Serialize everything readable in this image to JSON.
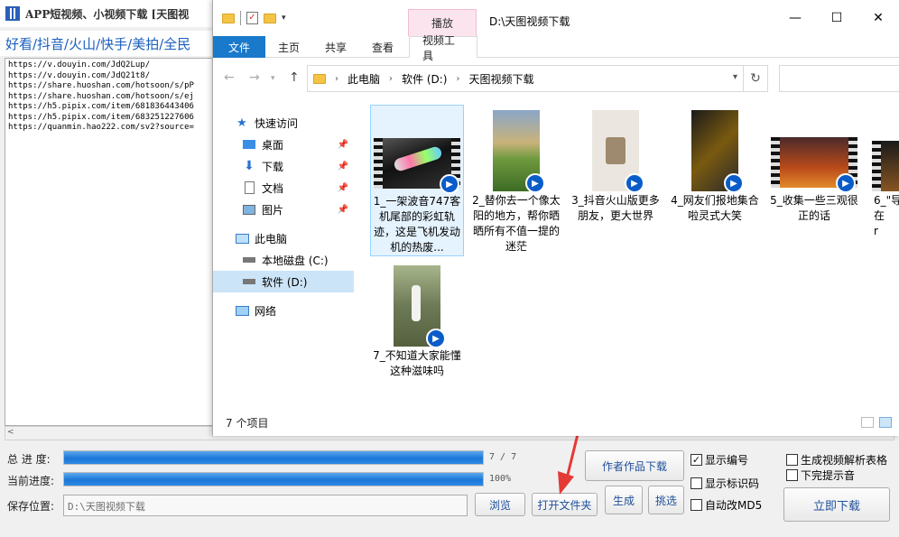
{
  "app": {
    "title": "APP短视频、小视频下载 [天图视",
    "platforms": "好看/抖音/火山/快手/美拍/全民",
    "urls": [
      "https://v.douyin.com/JdQ2Lup/",
      "https://v.douyin.com/JdQ21t8/",
      "https://share.huoshan.com/hotsoon/s/pP",
      "https://share.huoshan.com/hotsoon/s/ej",
      "https://h5.pipix.com/item/681836443406",
      "https://h5.pipix.com/item/683251227606",
      "https://quanmin.hao222.com/sv2?source="
    ],
    "total_progress_label": "总 进 度:",
    "total_progress_text": "7 / 7",
    "total_progress_fraction": 1.0,
    "current_progress_label": "当前进度:",
    "current_progress_text": "100%",
    "current_progress_fraction": 1.0,
    "save_label": "保存位置:",
    "save_path": "D:\\天图视频下载",
    "btn_browse": "浏览",
    "btn_open_folder": "打开文件夹",
    "btn_generate": "生成",
    "btn_pick": "挑选",
    "btn_author": "作者作品下载",
    "btn_download": "立即下载",
    "chk_show_number": "显示编号",
    "chk_show_mark": "显示标识码",
    "chk_auto_md5": "自动改MD5",
    "chk_gen_table": "生成视频解析表格",
    "chk_done_sound": "下完提示音"
  },
  "explorer": {
    "context_tab_top": "播放",
    "window_path": "D:\\天图视频下载",
    "ribbon_tabs": [
      "文件",
      "主页",
      "共享",
      "查看"
    ],
    "context_tab": "视频工具",
    "breadcrumb": [
      "此电脑",
      "软件 (D:)",
      "天图视频下载"
    ],
    "nav": {
      "quick_access": "快速访问",
      "desktop": "桌面",
      "downloads": "下载",
      "documents": "文档",
      "pictures": "图片",
      "this_pc": "此电脑",
      "local_c": "本地磁盘 (C:)",
      "soft_d": "软件 (D:)",
      "network": "网络"
    },
    "files": [
      "1_一架波音747客机尾部的彩虹轨迹，这是飞机发动机的热废...",
      "2_替你去一个像太阳的地方，帮你晒晒所有不值一提的迷茫",
      "3_抖音火山版更多朋友，更大世界",
      "4_网友们报地集合啦灵式大笑",
      "5_收集一些三观很正的话",
      "6_\"导\n在\nr",
      "7_不知道大家能懂这种滋味吗"
    ],
    "status_text": "7 个项目"
  }
}
